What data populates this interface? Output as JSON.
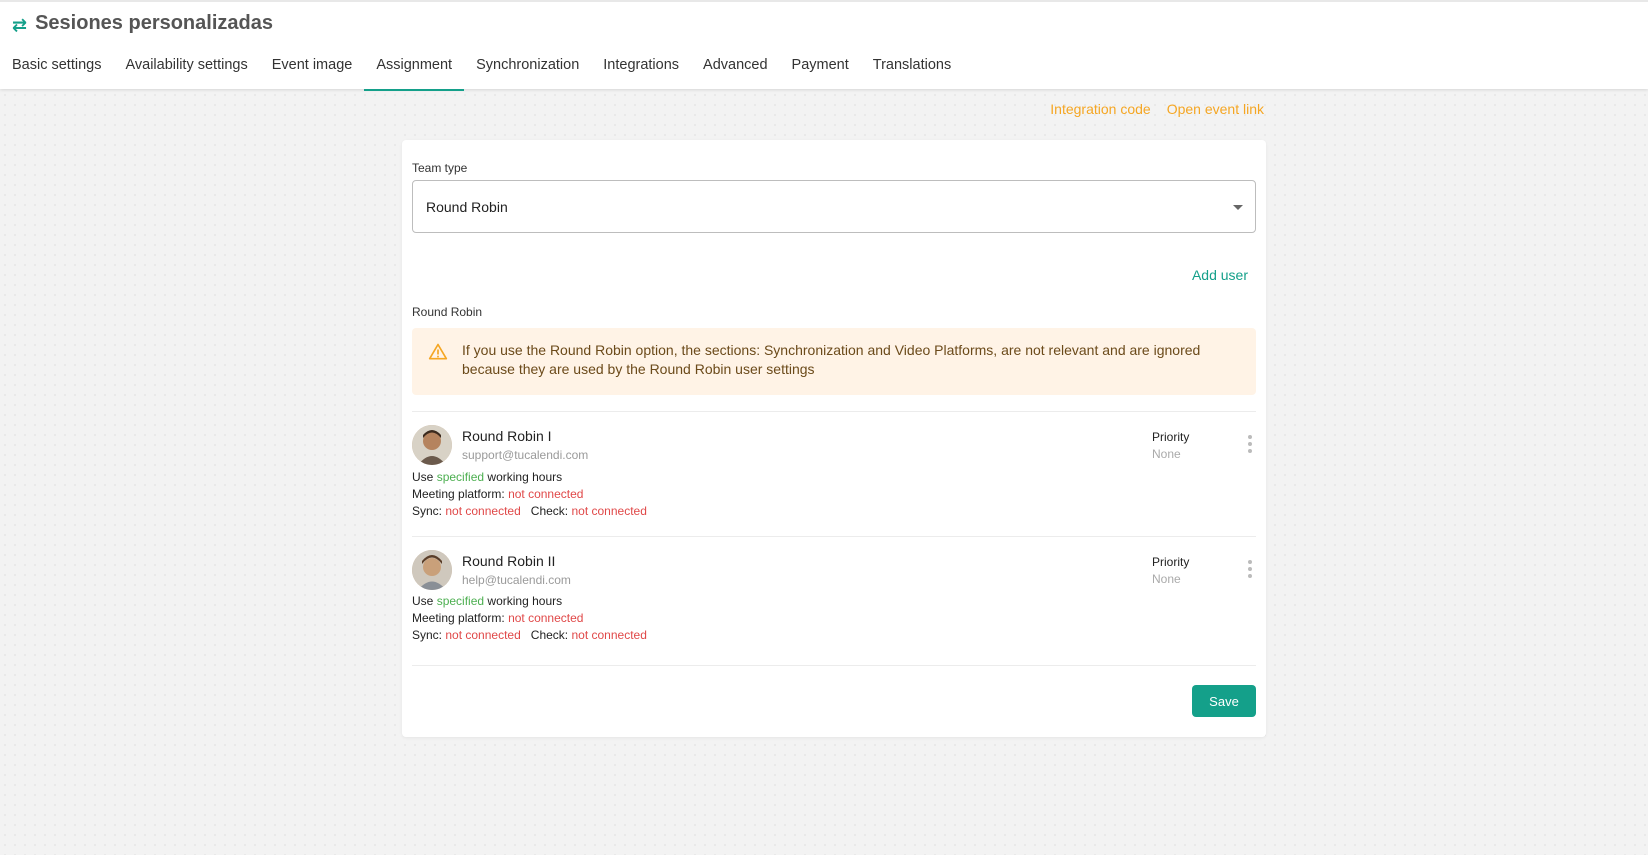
{
  "header": {
    "icon": "swap-arrows-icon",
    "title": "Sesiones personalizadas",
    "accent_color": "#14a08a"
  },
  "tabs": [
    {
      "label": "Basic settings"
    },
    {
      "label": "Availability settings"
    },
    {
      "label": "Event image"
    },
    {
      "label": "Assignment",
      "active": true
    },
    {
      "label": "Synchronization"
    },
    {
      "label": "Integrations"
    },
    {
      "label": "Advanced"
    },
    {
      "label": "Payment"
    },
    {
      "label": "Translations"
    }
  ],
  "top_links": {
    "integration_code": "Integration code",
    "open_event_link": "Open event link",
    "color": "#f5a623"
  },
  "team_type": {
    "label": "Team type",
    "value": "Round Robin"
  },
  "add_user_label": "Add user",
  "section_label": "Round Robin",
  "alert": {
    "icon": "warning-icon",
    "text": "If you use the Round Robin option, the sections: Synchronization and Video Platforms, are not relevant and are ignored because they are used by the Round Robin user settings",
    "background": "#fff3e6"
  },
  "users": [
    {
      "name": "Round Robin I",
      "email": "support@tucalendi.com",
      "priority_label": "Priority",
      "priority_value": "None",
      "use_prefix": "Use",
      "use_value": "specified",
      "use_suffix": "working hours",
      "meeting_label": "Meeting platform:",
      "meeting_value": "not connected",
      "sync_label": "Sync:",
      "sync_value": "not connected",
      "check_label": "Check:",
      "check_value": "not connected"
    },
    {
      "name": "Round Robin II",
      "email": "help@tucalendi.com",
      "priority_label": "Priority",
      "priority_value": "None",
      "use_prefix": "Use",
      "use_value": "specified",
      "use_suffix": "working hours",
      "meeting_label": "Meeting platform:",
      "meeting_value": "not connected",
      "sync_label": "Sync:",
      "sync_value": "not connected",
      "check_label": "Check:",
      "check_value": "not connected"
    }
  ],
  "save_label": "Save"
}
